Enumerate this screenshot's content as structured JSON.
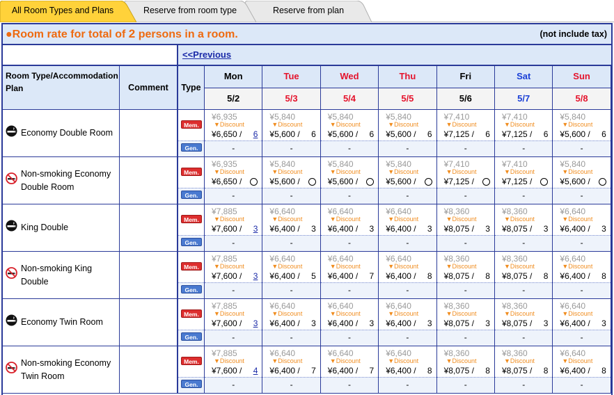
{
  "tabs": [
    {
      "label": "All Room Types and Plans",
      "active": true
    },
    {
      "label": "Reserve from room type",
      "active": false
    },
    {
      "label": "Reserve from plan",
      "active": false
    }
  ],
  "header": {
    "rate_prefix": "Room rate for total of ",
    "persons_count": "2",
    "rate_suffix": " persons in a room.",
    "tax_note": "(not include tax)"
  },
  "nav": {
    "previous_label": "<<Previous"
  },
  "columns": {
    "room_label": "Room Type/Accommodation Plan",
    "comment_label": "Comment",
    "type_label": "Type"
  },
  "days": [
    {
      "name": "Mon",
      "date": "5/2",
      "kind": "weekday"
    },
    {
      "name": "Tue",
      "date": "5/3",
      "kind": "holiday"
    },
    {
      "name": "Wed",
      "date": "5/4",
      "kind": "holiday"
    },
    {
      "name": "Thu",
      "date": "5/5",
      "kind": "holiday"
    },
    {
      "name": "Fri",
      "date": "5/6",
      "kind": "weekday"
    },
    {
      "name": "Sat",
      "date": "5/7",
      "kind": "sat"
    },
    {
      "name": "Sun",
      "date": "5/8",
      "kind": "holiday"
    }
  ],
  "badges": {
    "member": "Mem.",
    "general": "Gen."
  },
  "discount_label": "▼Discount",
  "general_placeholder": "-",
  "rooms": [
    {
      "name": "Economy Double Room",
      "smoking": true,
      "prices": [
        {
          "orig": "¥6,935",
          "final": "¥6,650 /",
          "avail": "6",
          "link": true
        },
        {
          "orig": "¥5,840",
          "final": "¥5,600 /",
          "avail": "6",
          "link": false
        },
        {
          "orig": "¥5,840",
          "final": "¥5,600 /",
          "avail": "6",
          "link": false
        },
        {
          "orig": "¥5,840",
          "final": "¥5,600 /",
          "avail": "6",
          "link": false
        },
        {
          "orig": "¥7,410",
          "final": "¥7,125 /",
          "avail": "6",
          "link": false
        },
        {
          "orig": "¥7,410",
          "final": "¥7,125 /",
          "avail": "6",
          "link": false
        },
        {
          "orig": "¥5,840",
          "final": "¥5,600 /",
          "avail": "6",
          "link": false
        }
      ]
    },
    {
      "name": "Non-smoking Economy Double Room",
      "smoking": false,
      "prices": [
        {
          "orig": "¥6,935",
          "final": "¥6,650 /",
          "avail": "circle",
          "link": false
        },
        {
          "orig": "¥5,840",
          "final": "¥5,600 /",
          "avail": "circle",
          "link": false
        },
        {
          "orig": "¥5,840",
          "final": "¥5,600 /",
          "avail": "circle",
          "link": false
        },
        {
          "orig": "¥5,840",
          "final": "¥5,600 /",
          "avail": "circle",
          "link": false
        },
        {
          "orig": "¥7,410",
          "final": "¥7,125 /",
          "avail": "circle",
          "link": false
        },
        {
          "orig": "¥7,410",
          "final": "¥7,125 /",
          "avail": "circle",
          "link": false
        },
        {
          "orig": "¥5,840",
          "final": "¥5,600 /",
          "avail": "circle",
          "link": false
        }
      ]
    },
    {
      "name": "King Double",
      "smoking": true,
      "prices": [
        {
          "orig": "¥7,885",
          "final": "¥7,600 /",
          "avail": "3",
          "link": true
        },
        {
          "orig": "¥6,640",
          "final": "¥6,400 /",
          "avail": "3",
          "link": false
        },
        {
          "orig": "¥6,640",
          "final": "¥6,400 /",
          "avail": "3",
          "link": false
        },
        {
          "orig": "¥6,640",
          "final": "¥6,400 /",
          "avail": "3",
          "link": false
        },
        {
          "orig": "¥8,360",
          "final": "¥8,075 /",
          "avail": "3",
          "link": false
        },
        {
          "orig": "¥8,360",
          "final": "¥8,075 /",
          "avail": "3",
          "link": false
        },
        {
          "orig": "¥6,640",
          "final": "¥6,400 /",
          "avail": "3",
          "link": false
        }
      ]
    },
    {
      "name": "Non-smoking King Double",
      "smoking": false,
      "prices": [
        {
          "orig": "¥7,885",
          "final": "¥7,600 /",
          "avail": "3",
          "link": true
        },
        {
          "orig": "¥6,640",
          "final": "¥6,400 /",
          "avail": "5",
          "link": false
        },
        {
          "orig": "¥6,640",
          "final": "¥6,400 /",
          "avail": "7",
          "link": false
        },
        {
          "orig": "¥6,640",
          "final": "¥6,400 /",
          "avail": "8",
          "link": false
        },
        {
          "orig": "¥8,360",
          "final": "¥8,075 /",
          "avail": "8",
          "link": false
        },
        {
          "orig": "¥8,360",
          "final": "¥8,075 /",
          "avail": "8",
          "link": false
        },
        {
          "orig": "¥6,640",
          "final": "¥6,400 /",
          "avail": "8",
          "link": false
        }
      ]
    },
    {
      "name": "Economy Twin Room",
      "smoking": true,
      "prices": [
        {
          "orig": "¥7,885",
          "final": "¥7,600 /",
          "avail": "3",
          "link": true
        },
        {
          "orig": "¥6,640",
          "final": "¥6,400 /",
          "avail": "3",
          "link": false
        },
        {
          "orig": "¥6,640",
          "final": "¥6,400 /",
          "avail": "3",
          "link": false
        },
        {
          "orig": "¥6,640",
          "final": "¥6,400 /",
          "avail": "3",
          "link": false
        },
        {
          "orig": "¥8,360",
          "final": "¥8,075 /",
          "avail": "3",
          "link": false
        },
        {
          "orig": "¥8,360",
          "final": "¥8,075 /",
          "avail": "3",
          "link": false
        },
        {
          "orig": "¥6,640",
          "final": "¥6,400 /",
          "avail": "3",
          "link": false
        }
      ]
    },
    {
      "name": "Non-smoking Economy Twin Room",
      "smoking": false,
      "prices": [
        {
          "orig": "¥7,885",
          "final": "¥7,600 /",
          "avail": "4",
          "link": true
        },
        {
          "orig": "¥6,640",
          "final": "¥6,400 /",
          "avail": "7",
          "link": false
        },
        {
          "orig": "¥6,640",
          "final": "¥6,400 /",
          "avail": "7",
          "link": false
        },
        {
          "orig": "¥6,640",
          "final": "¥6,400 /",
          "avail": "8",
          "link": false
        },
        {
          "orig": "¥8,360",
          "final": "¥8,075 /",
          "avail": "8",
          "link": false
        },
        {
          "orig": "¥8,360",
          "final": "¥8,075 /",
          "avail": "8",
          "link": false
        },
        {
          "orig": "¥6,640",
          "final": "¥6,400 /",
          "avail": "8",
          "link": false
        }
      ]
    }
  ],
  "colors": {
    "accent_orange": "#ee6a10",
    "border_blue": "#2a3a99",
    "header_bg": "#dce8f8",
    "holiday_red": "#e5132c",
    "saturday_blue": "#1a3fd6",
    "member_badge": "#dd2e2e",
    "general_badge": "#4a7ad0",
    "tab_active": "#ffd23a"
  }
}
